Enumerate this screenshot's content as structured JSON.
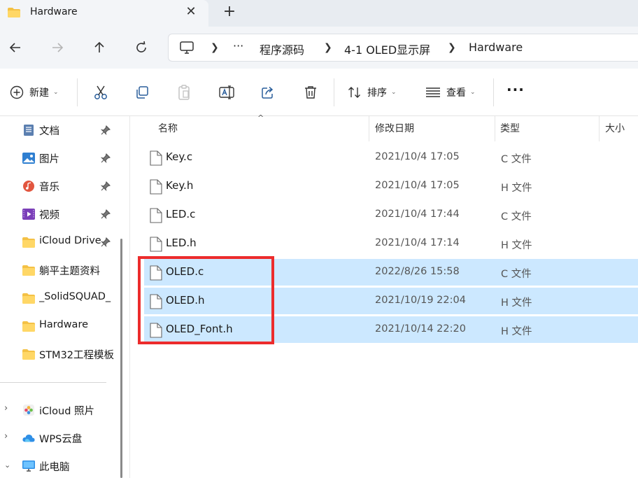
{
  "tab": {
    "title": "Hardware"
  },
  "breadcrumb": {
    "more": "···",
    "items": [
      "程序源码",
      "4-1 OLED显示屏",
      "Hardware"
    ]
  },
  "toolbar": {
    "new_label": "新建",
    "sort_label": "排序",
    "view_label": "查看",
    "more_label": "···"
  },
  "sidebar": {
    "quick_access": [
      {
        "label": "文档",
        "icon": "documents-icon",
        "pinned": true
      },
      {
        "label": "图片",
        "icon": "pictures-icon",
        "pinned": true
      },
      {
        "label": "音乐",
        "icon": "music-icon",
        "pinned": true
      },
      {
        "label": "视频",
        "icon": "videos-icon",
        "pinned": true
      },
      {
        "label": "iCloud Drive",
        "icon": "folder-icon",
        "pinned": true
      },
      {
        "label": "躺平主题资料",
        "icon": "folder-icon",
        "pinned": false
      },
      {
        "label": "_SolidSQUAD_",
        "icon": "folder-icon",
        "pinned": false
      },
      {
        "label": "Hardware",
        "icon": "folder-icon",
        "pinned": false
      },
      {
        "label": "STM32工程模板",
        "icon": "folder-icon",
        "pinned": false
      }
    ],
    "locations": [
      {
        "label": "iCloud 照片",
        "icon": "icloud-photos-icon",
        "expanded": false
      },
      {
        "label": "WPS云盘",
        "icon": "wps-cloud-icon",
        "expanded": false
      },
      {
        "label": "此电脑",
        "icon": "this-pc-icon",
        "expanded": true
      }
    ]
  },
  "columns": {
    "name": "名称",
    "modified": "修改日期",
    "type": "类型",
    "size": "大小"
  },
  "files": [
    {
      "name": "Key.c",
      "modified": "2021/10/4 17:05",
      "type": "C 文件",
      "selected": false
    },
    {
      "name": "Key.h",
      "modified": "2021/10/4 17:05",
      "type": "H 文件",
      "selected": false
    },
    {
      "name": "LED.c",
      "modified": "2021/10/4 17:44",
      "type": "C 文件",
      "selected": false
    },
    {
      "name": "LED.h",
      "modified": "2021/10/4 17:14",
      "type": "H 文件",
      "selected": false
    },
    {
      "name": "OLED.c",
      "modified": "2022/8/26 15:58",
      "type": "C 文件",
      "selected": true
    },
    {
      "name": "OLED.h",
      "modified": "2021/10/19 22:04",
      "type": "H 文件",
      "selected": true
    },
    {
      "name": "OLED_Font.h",
      "modified": "2021/10/14 22:20",
      "type": "H 文件",
      "selected": true
    }
  ],
  "colors": {
    "selection": "#cce8ff",
    "highlight_box": "#ec2c2c",
    "folder": "#f4c145"
  }
}
